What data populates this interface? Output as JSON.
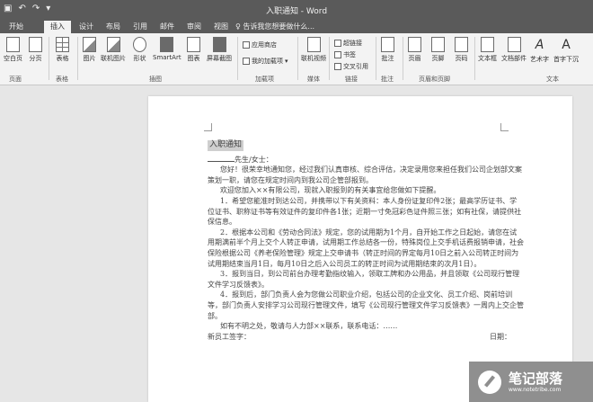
{
  "window": {
    "title": "入职通知 - Word"
  },
  "tell_me": "告诉我您想要做什么...",
  "tabs": [
    "开始",
    "插入",
    "设计",
    "布局",
    "引用",
    "邮件",
    "审阅",
    "视图"
  ],
  "active_tab": "插入",
  "ribbon": {
    "groups": {
      "pages": "页面",
      "tables": "表格",
      "illustrations": "插图",
      "addins": "加载项",
      "media": "媒体",
      "links": "链接",
      "comments": "批注",
      "header_footer": "页眉和页脚",
      "text": "文本"
    },
    "buttons": {
      "blank_page": "空白页",
      "page_break": "分页",
      "table": "表格",
      "pictures": "图片",
      "online_pictures": "联机图片",
      "shapes": "形状",
      "smartart": "SmartArt",
      "chart": "图表",
      "screenshot": "屏幕截图",
      "store": "应用商店",
      "my_addins": "我的加载项",
      "online_video": "联机视频",
      "hyperlink": "超链接",
      "bookmark": "书签",
      "cross_reference": "交叉引用",
      "comment": "批注",
      "header": "页眉",
      "footer": "页脚",
      "page_number": "页码",
      "text_box": "文本框",
      "quick_parts": "文档部件",
      "wordart": "艺术字",
      "drop_cap": "首字下沉"
    }
  },
  "document": {
    "title": "入职通知",
    "salutation": "先生/女士：",
    "p1": "您好！很荣幸地通知您，经过我们认真审核、综合评估，决定录用您来担任我们公司企划部文案策划一职，请您在规定时间内到我公司企管部报到。",
    "p2": "欢迎您加入××有限公司，现就入职报到的有关事宜给您做如下提醒。",
    "p3": "1．希望您能准时到达公司，并携带以下有关资料：本人身份证复印件2张；最高学历证书、学位证书、职称证书等有效证件的复印件各1张；近期一寸免冠彩色证件照三张；如有社保，请提供社保信息。",
    "p4": "2．根据本公司和《劳动合同法》规定，您的试用期为1个月，自开始工作之日起始，请您在试用期满前半个月上交个人转正申请，试用期工作总结各一份，特殊岗位上交手机话费报销申请，社会保险根据公司《养老保险管理》规定上交申请书（转正时间的界定每月10日之前入公司转正时间为试用期结束当月1日，每月10日之后入公司员工的转正时间为试用期结束的次月1日）。",
    "p5": "3．报到当日，到公司前台办理考勤指纹输入，领取工牌和办公用品，并且领取《公司现行管理文件学习反馈表》。",
    "p6": "4．报到后，部门负责人会为您做公司职业介绍，包括公司的企业文化、员工介绍、岗前培训等，部门负责人安排学习公司现行管理文件，填写《公司现行管理文件学习反馈表》一周内上交企管部。",
    "p7": "如有不明之处，敬请与人力部××联系，联系电话：……",
    "sign_label": "新员工签字：",
    "date_label": "日期："
  },
  "watermark": {
    "name": "笔记部落",
    "url": "www.notetribe.com"
  }
}
